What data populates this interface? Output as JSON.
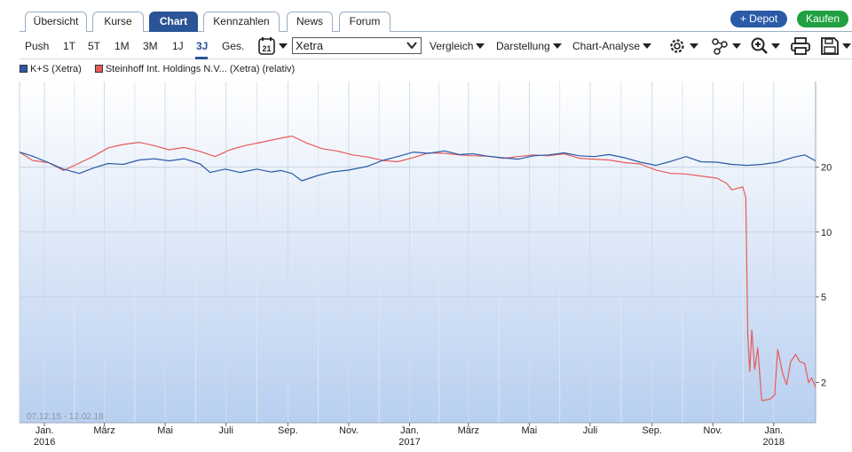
{
  "tabs": [
    {
      "label": "Übersicht",
      "active": false
    },
    {
      "label": "Kurse",
      "active": false
    },
    {
      "label": "Chart",
      "active": true
    },
    {
      "label": "Kennzahlen",
      "active": false
    },
    {
      "label": "News",
      "active": false
    },
    {
      "label": "Forum",
      "active": false
    }
  ],
  "actions": {
    "depot": "+ Depot",
    "kaufen": "Kaufen"
  },
  "toolbar": {
    "push": "Push",
    "ranges": [
      "1T",
      "5T",
      "1M",
      "3M",
      "1J",
      "3J",
      "Ges."
    ],
    "active_range": "3J",
    "calendar_day": "21",
    "exchange": "Xetra",
    "vergleich": "Vergleich",
    "darstellung": "Darstellung",
    "analyse": "Chart-Analyse"
  },
  "legend": [
    {
      "label": "K+S (Xetra)",
      "color": "#2a5aa8"
    },
    {
      "label": "Steinhoff Int. Holdings N.V... (Xetra) (relativ)",
      "color": "#e85a5a"
    }
  ],
  "date_range": "07.12.15 - 12.02.18",
  "colors": {
    "ks": "#2a5aa8",
    "steinhoff": "#e85a5a",
    "accent": "#2a5496"
  },
  "chart_data": {
    "type": "line",
    "yscale": "log",
    "y_ticks": [
      20,
      10,
      5,
      2
    ],
    "ylim": [
      1.3,
      50
    ],
    "x_ticks": [
      {
        "label": "Jan.",
        "sub": "2016",
        "date": "2016-01-01"
      },
      {
        "label": "März",
        "sub": "",
        "date": "2016-03-01"
      },
      {
        "label": "Mai",
        "sub": "",
        "date": "2016-05-01"
      },
      {
        "label": "Juli",
        "sub": "",
        "date": "2016-07-01"
      },
      {
        "label": "Sep.",
        "sub": "",
        "date": "2016-09-01"
      },
      {
        "label": "Nov.",
        "sub": "",
        "date": "2016-11-01"
      },
      {
        "label": "Jan.",
        "sub": "2017",
        "date": "2017-01-01"
      },
      {
        "label": "März",
        "sub": "",
        "date": "2017-03-01"
      },
      {
        "label": "Mai",
        "sub": "",
        "date": "2017-05-01"
      },
      {
        "label": "Juli",
        "sub": "",
        "date": "2017-07-01"
      },
      {
        "label": "Sep.",
        "sub": "",
        "date": "2017-09-01"
      },
      {
        "label": "Nov.",
        "sub": "",
        "date": "2017-11-01"
      },
      {
        "label": "Jan.",
        "sub": "2018",
        "date": "2018-01-01"
      }
    ],
    "xlim": [
      "2015-12-07",
      "2018-02-12"
    ],
    "series": [
      {
        "name": "K+S (Xetra)",
        "color": "#2a5aa8",
        "points": [
          [
            "2015-12-07",
            23.5
          ],
          [
            "2015-12-20",
            22.5
          ],
          [
            "2016-01-05",
            21.0
          ],
          [
            "2016-01-20",
            19.6
          ],
          [
            "2016-02-05",
            18.7
          ],
          [
            "2016-02-20",
            19.9
          ],
          [
            "2016-03-05",
            20.8
          ],
          [
            "2016-03-20",
            20.6
          ],
          [
            "2016-04-05",
            21.6
          ],
          [
            "2016-04-20",
            21.9
          ],
          [
            "2016-05-05",
            21.4
          ],
          [
            "2016-05-20",
            21.9
          ],
          [
            "2016-06-05",
            20.7
          ],
          [
            "2016-06-15",
            18.9
          ],
          [
            "2016-06-30",
            19.6
          ],
          [
            "2016-07-15",
            18.9
          ],
          [
            "2016-08-01",
            19.6
          ],
          [
            "2016-08-15",
            19.0
          ],
          [
            "2016-08-25",
            19.3
          ],
          [
            "2016-09-05",
            18.7
          ],
          [
            "2016-09-15",
            17.3
          ],
          [
            "2016-10-01",
            18.3
          ],
          [
            "2016-10-15",
            19.0
          ],
          [
            "2016-11-01",
            19.4
          ],
          [
            "2016-11-20",
            20.2
          ],
          [
            "2016-12-05",
            21.5
          ],
          [
            "2016-12-20",
            22.4
          ],
          [
            "2017-01-05",
            23.5
          ],
          [
            "2017-01-20",
            23.2
          ],
          [
            "2017-02-05",
            23.8
          ],
          [
            "2017-02-20",
            22.9
          ],
          [
            "2017-03-05",
            23.1
          ],
          [
            "2017-03-20",
            22.5
          ],
          [
            "2017-04-05",
            22.1
          ],
          [
            "2017-04-20",
            21.8
          ],
          [
            "2017-05-05",
            22.6
          ],
          [
            "2017-05-20",
            22.8
          ],
          [
            "2017-06-05",
            23.3
          ],
          [
            "2017-06-20",
            22.6
          ],
          [
            "2017-07-05",
            22.4
          ],
          [
            "2017-07-20",
            22.9
          ],
          [
            "2017-08-05",
            22.1
          ],
          [
            "2017-08-20",
            21.1
          ],
          [
            "2017-09-05",
            20.4
          ],
          [
            "2017-09-20",
            21.3
          ],
          [
            "2017-10-05",
            22.4
          ],
          [
            "2017-10-20",
            21.2
          ],
          [
            "2017-11-05",
            21.1
          ],
          [
            "2017-11-20",
            20.6
          ],
          [
            "2017-12-05",
            20.4
          ],
          [
            "2017-12-20",
            20.6
          ],
          [
            "2018-01-05",
            21.1
          ],
          [
            "2018-01-20",
            22.2
          ],
          [
            "2018-02-01",
            22.8
          ],
          [
            "2018-02-12",
            21.4
          ]
        ]
      },
      {
        "name": "Steinhoff Int. Holdings N.V... (Xetra) (relativ)",
        "color": "#e85a5a",
        "points": [
          [
            "2015-12-07",
            23.5
          ],
          [
            "2015-12-20",
            21.5
          ],
          [
            "2016-01-05",
            21.0
          ],
          [
            "2016-01-20",
            19.3
          ],
          [
            "2016-02-05",
            20.9
          ],
          [
            "2016-02-20",
            22.6
          ],
          [
            "2016-03-05",
            24.6
          ],
          [
            "2016-03-20",
            25.5
          ],
          [
            "2016-04-05",
            26.1
          ],
          [
            "2016-04-20",
            25.2
          ],
          [
            "2016-05-05",
            24.1
          ],
          [
            "2016-05-20",
            24.7
          ],
          [
            "2016-06-05",
            23.7
          ],
          [
            "2016-06-20",
            22.4
          ],
          [
            "2016-07-05",
            24.1
          ],
          [
            "2016-07-20",
            25.2
          ],
          [
            "2016-08-05",
            26.1
          ],
          [
            "2016-08-20",
            27.0
          ],
          [
            "2016-09-05",
            27.9
          ],
          [
            "2016-09-20",
            25.9
          ],
          [
            "2016-10-05",
            24.4
          ],
          [
            "2016-10-20",
            23.8
          ],
          [
            "2016-11-05",
            22.8
          ],
          [
            "2016-11-20",
            22.3
          ],
          [
            "2016-12-05",
            21.5
          ],
          [
            "2016-12-20",
            21.2
          ],
          [
            "2017-01-05",
            22.2
          ],
          [
            "2017-01-20",
            23.3
          ],
          [
            "2017-02-05",
            23.2
          ],
          [
            "2017-02-20",
            22.8
          ],
          [
            "2017-03-05",
            22.6
          ],
          [
            "2017-03-20",
            22.5
          ],
          [
            "2017-04-05",
            22.0
          ],
          [
            "2017-04-20",
            22.4
          ],
          [
            "2017-05-05",
            22.8
          ],
          [
            "2017-05-20",
            22.6
          ],
          [
            "2017-06-05",
            23.1
          ],
          [
            "2017-06-20",
            22.0
          ],
          [
            "2017-07-05",
            21.8
          ],
          [
            "2017-07-20",
            21.6
          ],
          [
            "2017-08-05",
            21.0
          ],
          [
            "2017-08-20",
            20.7
          ],
          [
            "2017-09-05",
            19.4
          ],
          [
            "2017-09-20",
            18.7
          ],
          [
            "2017-10-05",
            18.6
          ],
          [
            "2017-10-20",
            18.2
          ],
          [
            "2017-11-05",
            17.8
          ],
          [
            "2017-11-15",
            16.8
          ],
          [
            "2017-11-20",
            15.7
          ],
          [
            "2017-12-01",
            16.2
          ],
          [
            "2017-12-04",
            14.5
          ],
          [
            "2017-12-06",
            3.3
          ],
          [
            "2017-12-08",
            2.25
          ],
          [
            "2017-12-10",
            3.5
          ],
          [
            "2017-12-13",
            2.3
          ],
          [
            "2017-12-16",
            2.9
          ],
          [
            "2017-12-20",
            1.65
          ],
          [
            "2017-12-28",
            1.67
          ],
          [
            "2018-01-02",
            1.75
          ],
          [
            "2018-01-05",
            2.85
          ],
          [
            "2018-01-10",
            2.2
          ],
          [
            "2018-01-14",
            1.95
          ],
          [
            "2018-01-18",
            2.5
          ],
          [
            "2018-01-23",
            2.7
          ],
          [
            "2018-01-27",
            2.5
          ],
          [
            "2018-02-01",
            2.45
          ],
          [
            "2018-02-05",
            2.0
          ],
          [
            "2018-02-08",
            2.1
          ],
          [
            "2018-02-12",
            1.9
          ]
        ]
      }
    ]
  }
}
